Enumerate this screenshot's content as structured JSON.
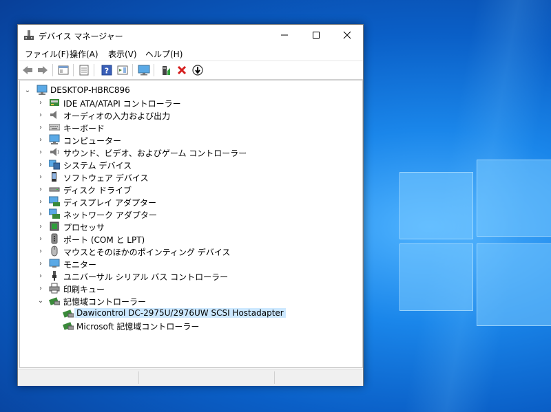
{
  "window": {
    "title": "デバイス マネージャー"
  },
  "menu": [
    "ファイル(F)",
    "操作(A)",
    "表示(V)",
    "ヘルプ(H)"
  ],
  "toolbar": {
    "buttons": [
      "back-icon",
      "forward-icon",
      "properties-panel-icon",
      "list-icon",
      "help-icon",
      "action-pane-icon",
      "monitor-scan-icon",
      "update-driver-icon",
      "uninstall-icon",
      "disable-icon"
    ]
  },
  "tree": {
    "root": "DESKTOP-HBRC896",
    "categories": [
      "IDE ATA/ATAPI コントローラー",
      "オーディオの入力および出力",
      "キーボード",
      "コンピューター",
      "サウンド、ビデオ、およびゲーム コントローラー",
      "システム デバイス",
      "ソフトウェア デバイス",
      "ディスク ドライブ",
      "ディスプレイ アダプター",
      "ネットワーク アダプター",
      "プロセッサ",
      "ポート (COM と LPT)",
      "マウスとそのほかのポインティング デバイス",
      "モニター",
      "ユニバーサル シリアル バス コントローラー",
      "印刷キュー",
      "記憶域コントローラー"
    ],
    "children": [
      "Dawicontrol DC-2975U/2976UW SCSI Hostadapter",
      "Microsoft 記憶域コントローラー"
    ],
    "selected_color": "#cce8ff"
  }
}
